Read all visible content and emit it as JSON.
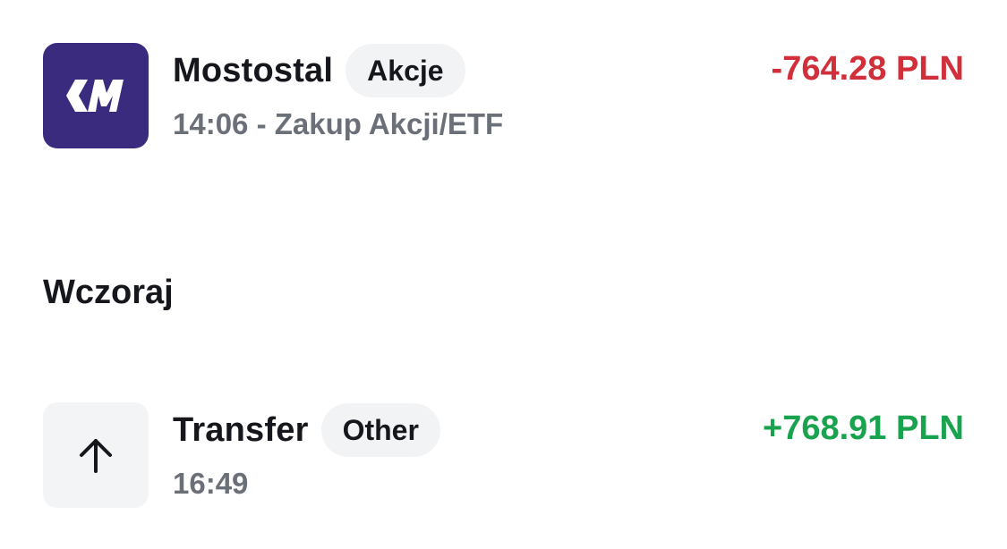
{
  "colors": {
    "negative": "#d1303b",
    "positive": "#1aa34e",
    "brand_logo_bg": "#3b2b7f",
    "secondary_text": "#6b6f78",
    "badge_bg": "#f2f3f5"
  },
  "transactions_today": [
    {
      "name": "Mostostal",
      "badge": "Akcje",
      "subtitle": "14:06 - Zakup Akcji/ETF",
      "amount": "-764.28 PLN",
      "icon": "mostostal-logo-icon"
    }
  ],
  "section_yesterday": {
    "title": "Wczoraj"
  },
  "transactions_yesterday": [
    {
      "name": "Transfer",
      "badge": "Other",
      "subtitle": "16:49",
      "amount": "+768.91 PLN",
      "icon": "arrow-up-icon"
    }
  ]
}
